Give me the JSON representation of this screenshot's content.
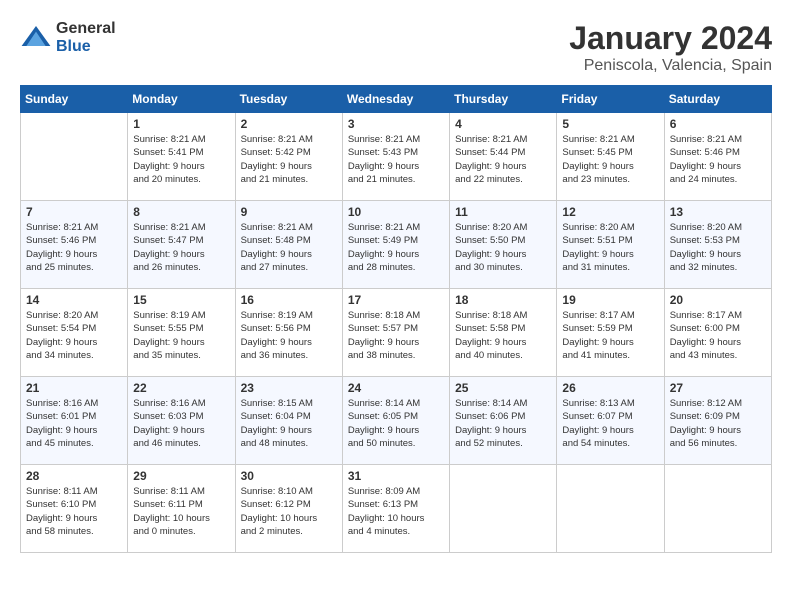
{
  "header": {
    "logo": {
      "general": "General",
      "blue": "Blue"
    },
    "title": "January 2024",
    "location": "Peniscola, Valencia, Spain"
  },
  "weekdays": [
    "Sunday",
    "Monday",
    "Tuesday",
    "Wednesday",
    "Thursday",
    "Friday",
    "Saturday"
  ],
  "weeks": [
    [
      {
        "day": "",
        "info": ""
      },
      {
        "day": "1",
        "info": "Sunrise: 8:21 AM\nSunset: 5:41 PM\nDaylight: 9 hours\nand 20 minutes."
      },
      {
        "day": "2",
        "info": "Sunrise: 8:21 AM\nSunset: 5:42 PM\nDaylight: 9 hours\nand 21 minutes."
      },
      {
        "day": "3",
        "info": "Sunrise: 8:21 AM\nSunset: 5:43 PM\nDaylight: 9 hours\nand 21 minutes."
      },
      {
        "day": "4",
        "info": "Sunrise: 8:21 AM\nSunset: 5:44 PM\nDaylight: 9 hours\nand 22 minutes."
      },
      {
        "day": "5",
        "info": "Sunrise: 8:21 AM\nSunset: 5:45 PM\nDaylight: 9 hours\nand 23 minutes."
      },
      {
        "day": "6",
        "info": "Sunrise: 8:21 AM\nSunset: 5:46 PM\nDaylight: 9 hours\nand 24 minutes."
      }
    ],
    [
      {
        "day": "7",
        "info": "Sunrise: 8:21 AM\nSunset: 5:46 PM\nDaylight: 9 hours\nand 25 minutes."
      },
      {
        "day": "8",
        "info": "Sunrise: 8:21 AM\nSunset: 5:47 PM\nDaylight: 9 hours\nand 26 minutes."
      },
      {
        "day": "9",
        "info": "Sunrise: 8:21 AM\nSunset: 5:48 PM\nDaylight: 9 hours\nand 27 minutes."
      },
      {
        "day": "10",
        "info": "Sunrise: 8:21 AM\nSunset: 5:49 PM\nDaylight: 9 hours\nand 28 minutes."
      },
      {
        "day": "11",
        "info": "Sunrise: 8:20 AM\nSunset: 5:50 PM\nDaylight: 9 hours\nand 30 minutes."
      },
      {
        "day": "12",
        "info": "Sunrise: 8:20 AM\nSunset: 5:51 PM\nDaylight: 9 hours\nand 31 minutes."
      },
      {
        "day": "13",
        "info": "Sunrise: 8:20 AM\nSunset: 5:53 PM\nDaylight: 9 hours\nand 32 minutes."
      }
    ],
    [
      {
        "day": "14",
        "info": "Sunrise: 8:20 AM\nSunset: 5:54 PM\nDaylight: 9 hours\nand 34 minutes."
      },
      {
        "day": "15",
        "info": "Sunrise: 8:19 AM\nSunset: 5:55 PM\nDaylight: 9 hours\nand 35 minutes."
      },
      {
        "day": "16",
        "info": "Sunrise: 8:19 AM\nSunset: 5:56 PM\nDaylight: 9 hours\nand 36 minutes."
      },
      {
        "day": "17",
        "info": "Sunrise: 8:18 AM\nSunset: 5:57 PM\nDaylight: 9 hours\nand 38 minutes."
      },
      {
        "day": "18",
        "info": "Sunrise: 8:18 AM\nSunset: 5:58 PM\nDaylight: 9 hours\nand 40 minutes."
      },
      {
        "day": "19",
        "info": "Sunrise: 8:17 AM\nSunset: 5:59 PM\nDaylight: 9 hours\nand 41 minutes."
      },
      {
        "day": "20",
        "info": "Sunrise: 8:17 AM\nSunset: 6:00 PM\nDaylight: 9 hours\nand 43 minutes."
      }
    ],
    [
      {
        "day": "21",
        "info": "Sunrise: 8:16 AM\nSunset: 6:01 PM\nDaylight: 9 hours\nand 45 minutes."
      },
      {
        "day": "22",
        "info": "Sunrise: 8:16 AM\nSunset: 6:03 PM\nDaylight: 9 hours\nand 46 minutes."
      },
      {
        "day": "23",
        "info": "Sunrise: 8:15 AM\nSunset: 6:04 PM\nDaylight: 9 hours\nand 48 minutes."
      },
      {
        "day": "24",
        "info": "Sunrise: 8:14 AM\nSunset: 6:05 PM\nDaylight: 9 hours\nand 50 minutes."
      },
      {
        "day": "25",
        "info": "Sunrise: 8:14 AM\nSunset: 6:06 PM\nDaylight: 9 hours\nand 52 minutes."
      },
      {
        "day": "26",
        "info": "Sunrise: 8:13 AM\nSunset: 6:07 PM\nDaylight: 9 hours\nand 54 minutes."
      },
      {
        "day": "27",
        "info": "Sunrise: 8:12 AM\nSunset: 6:09 PM\nDaylight: 9 hours\nand 56 minutes."
      }
    ],
    [
      {
        "day": "28",
        "info": "Sunrise: 8:11 AM\nSunset: 6:10 PM\nDaylight: 9 hours\nand 58 minutes."
      },
      {
        "day": "29",
        "info": "Sunrise: 8:11 AM\nSunset: 6:11 PM\nDaylight: 10 hours\nand 0 minutes."
      },
      {
        "day": "30",
        "info": "Sunrise: 8:10 AM\nSunset: 6:12 PM\nDaylight: 10 hours\nand 2 minutes."
      },
      {
        "day": "31",
        "info": "Sunrise: 8:09 AM\nSunset: 6:13 PM\nDaylight: 10 hours\nand 4 minutes."
      },
      {
        "day": "",
        "info": ""
      },
      {
        "day": "",
        "info": ""
      },
      {
        "day": "",
        "info": ""
      }
    ]
  ]
}
